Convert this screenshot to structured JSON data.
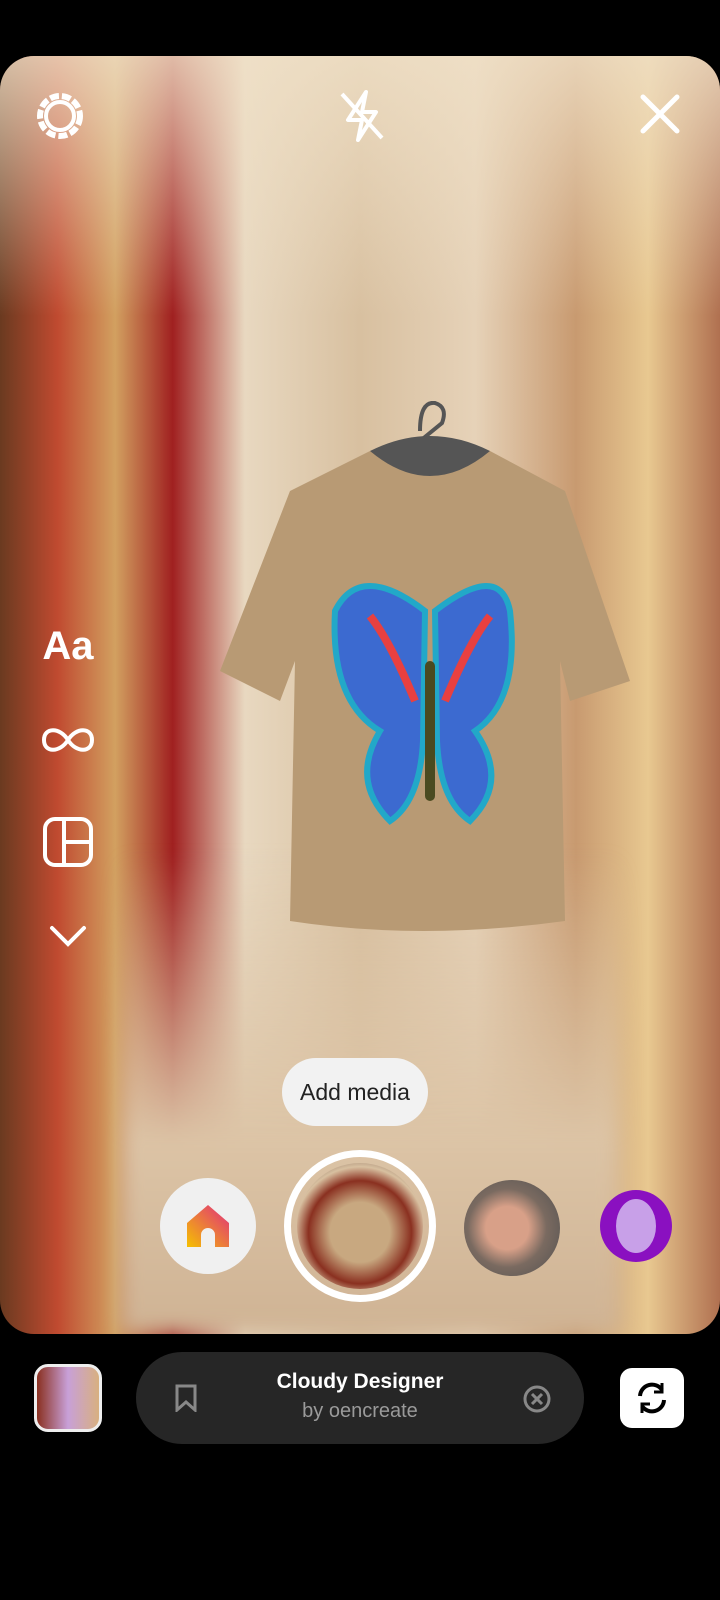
{
  "top": {
    "settings": "settings-icon",
    "flash": "flash-off-icon",
    "close": "close-icon"
  },
  "side": {
    "text_label": "Aa",
    "boomerang": "infinity-icon",
    "layout": "layout-icon",
    "more": "chevron-down-icon"
  },
  "tooltip": "Add media",
  "effects": [
    "home",
    "cloudy-designer",
    "face-filter",
    "alien-filter"
  ],
  "effect_bar": {
    "title": "Cloudy Designer",
    "creator": "by oencreate"
  },
  "colors": {
    "bar": "#262626",
    "accent_gradient": [
      "#f5c000",
      "#e02c80"
    ],
    "alien": "#8a10c0"
  }
}
